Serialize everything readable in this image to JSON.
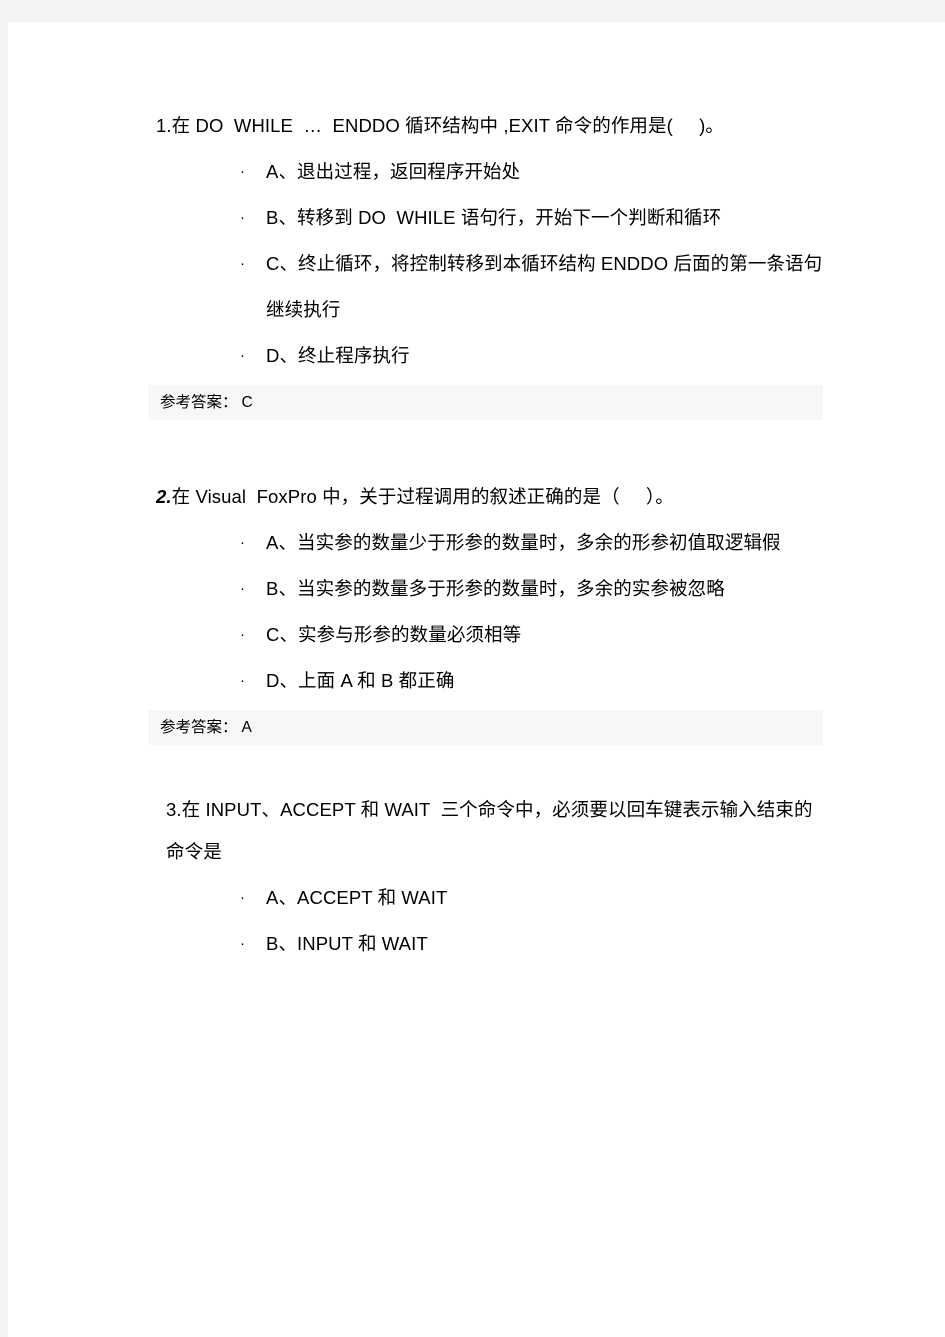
{
  "document": {
    "page_background": "#f4f4f4",
    "sheet_background": "#ffffff",
    "answer_strip_background": "#f7f7f7",
    "answer_label": "参考答案：",
    "bullet_glyph": "·"
  },
  "questions": [
    {
      "number": "1.",
      "number_emphasis": false,
      "stem": "在 DO  WHILE  …  ENDDO 循环结构中 ,EXIT 命令的作用是(     )。",
      "options": [
        "A、退出过程，返回程序开始处",
        "B、转移到 DO  WHILE 语句行，开始下一个判断和循环",
        "C、终止循环，将控制转移到本循环结构 ENDDO 后面的第一条语句继续执行",
        "D、终止程序执行"
      ],
      "answer": "C"
    },
    {
      "number": "2.",
      "number_emphasis": true,
      "stem": "在 Visual  FoxPro 中，关于过程调用的叙述正确的是（     ）。",
      "options": [
        "A、当实参的数量少于形参的数量时，多余的形参初值取逻辑假",
        "B、当实参的数量多于形参的数量时，多余的实参被忽略",
        "C、实参与形参的数量必须相等",
        "D、上面 A 和 B 都正确"
      ],
      "answer": "A"
    },
    {
      "number": "3.",
      "number_emphasis": false,
      "stem": "在 INPUT、ACCEPT 和 WAIT  三个命令中，必须要以回车键表示输入结束的命令是",
      "options": [
        "A、ACCEPT 和 WAIT",
        "B、INPUT 和 WAIT"
      ],
      "answer": ""
    }
  ]
}
